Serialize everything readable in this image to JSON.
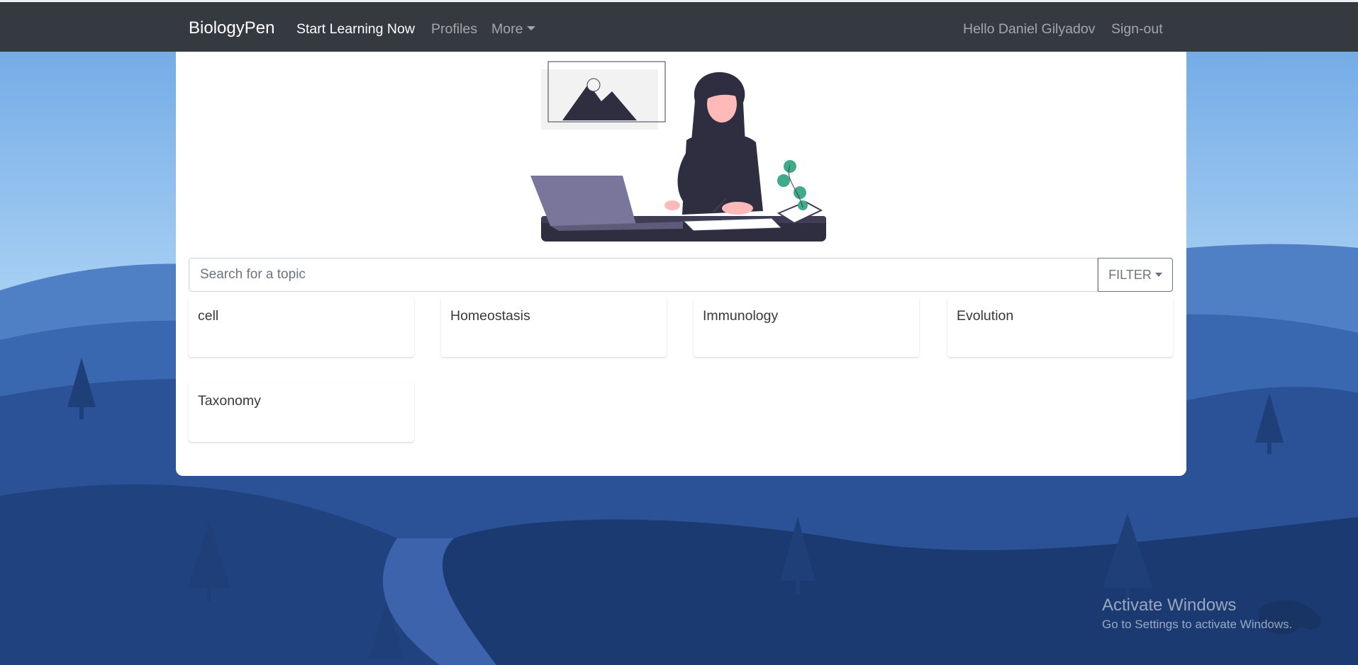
{
  "navbar": {
    "brand": "BiologyPen",
    "links": [
      {
        "label": "Start Learning Now",
        "active": true
      },
      {
        "label": "Profiles",
        "active": false
      },
      {
        "label": "More",
        "active": false
      }
    ],
    "greeting": "Hello Daniel Gilyadov",
    "signout": "Sign-out"
  },
  "search": {
    "placeholder": "Search for a topic",
    "filter_label": "FILTER"
  },
  "topics": [
    "cell",
    "Homeostasis",
    "Immunology",
    "Evolution",
    "Taxonomy"
  ],
  "watermark": {
    "title": "Activate Windows",
    "subtitle": "Go to Settings to activate Windows."
  },
  "colors": {
    "navbar": "#343a40",
    "sky_top": "#7fb1e6",
    "hills_dark": "#1e3a6e",
    "card": "#ffffff",
    "accent_green": "#3fab8b"
  },
  "icons": {
    "hero": "woman-at-laptop-illustration",
    "filter": "caret-down-icon",
    "more": "caret-down-icon"
  }
}
